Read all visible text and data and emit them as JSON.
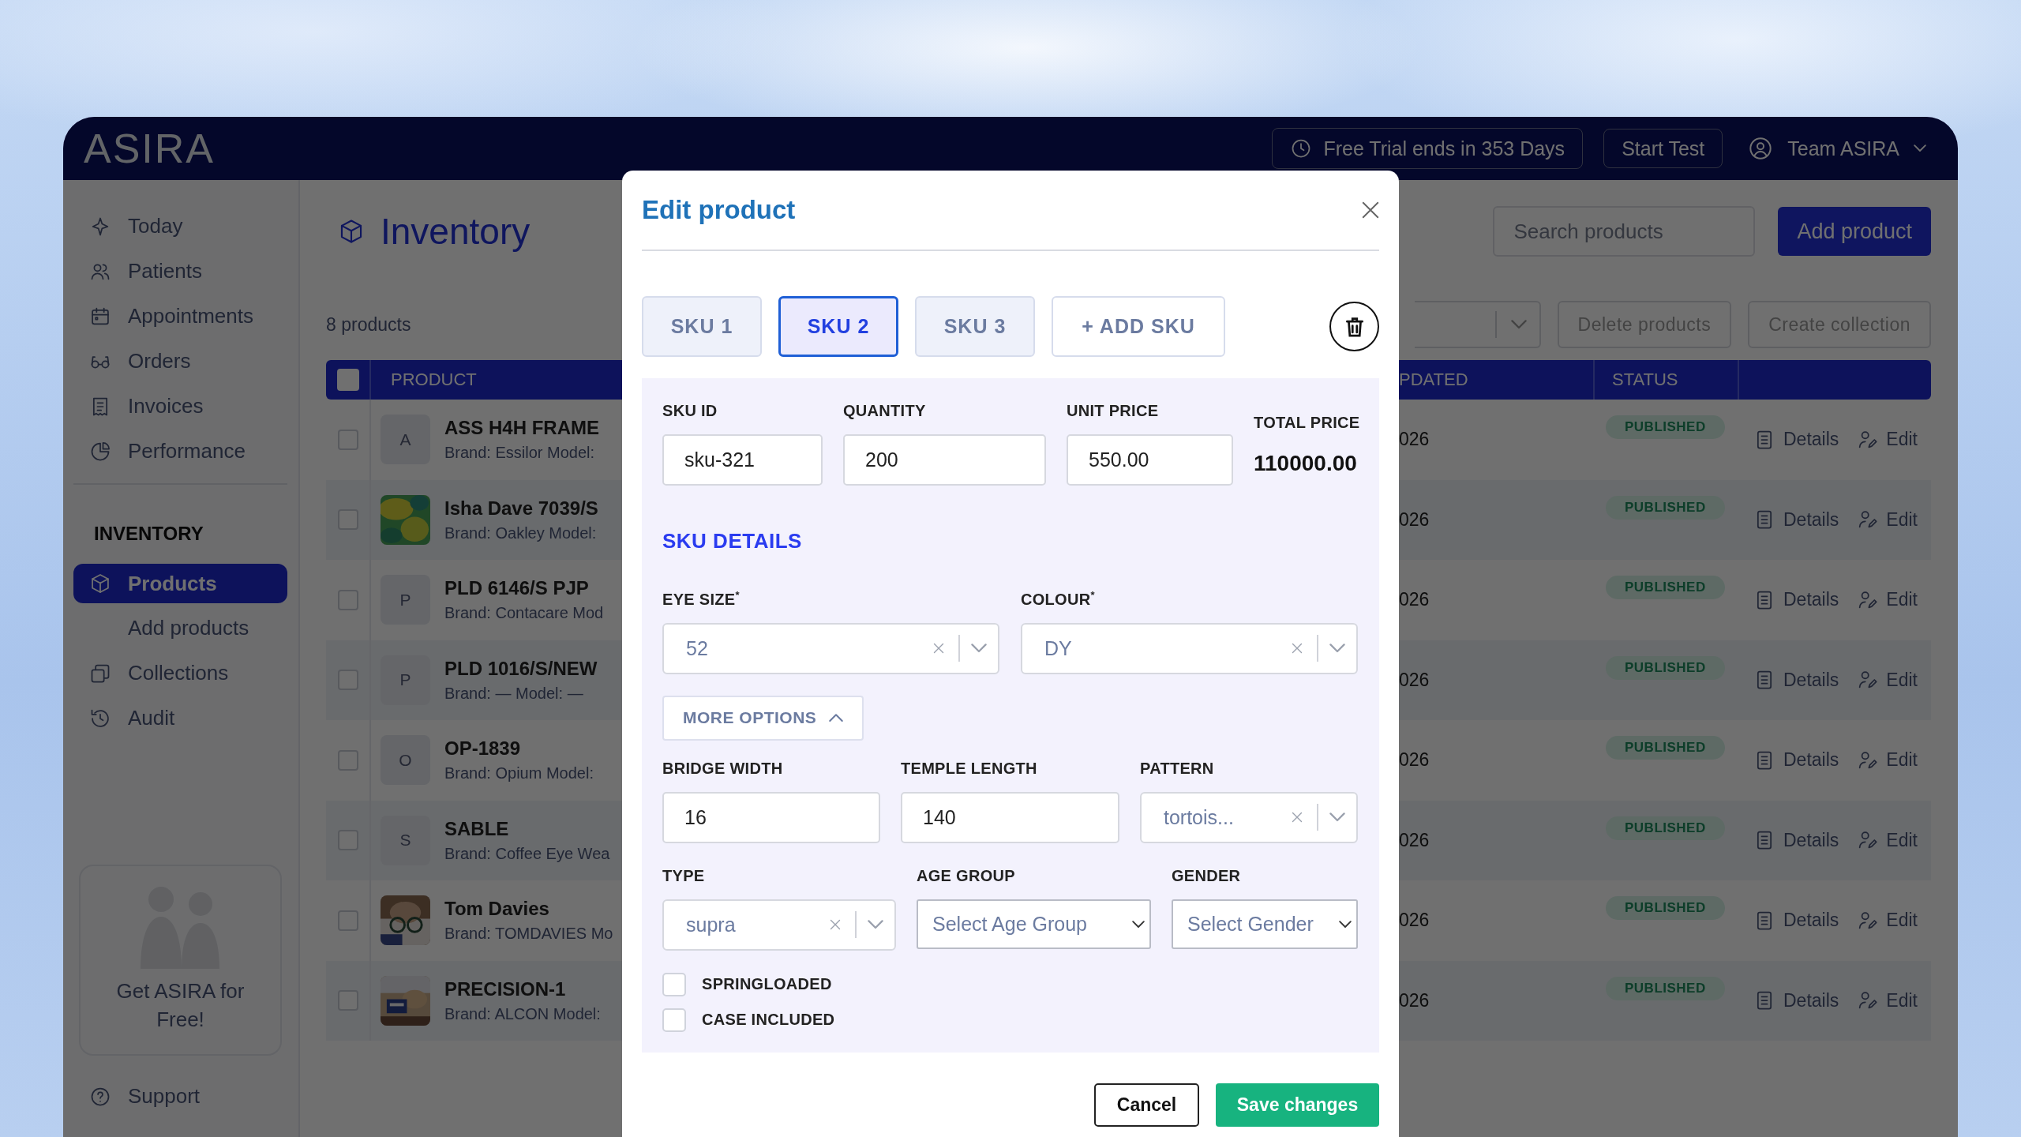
{
  "topbar": {
    "logo": "ASIRA",
    "trial": "Free Trial ends in 353 Days",
    "start_test": "Start Test",
    "user": "Team ASIRA"
  },
  "sidebar": {
    "items": [
      {
        "label": "Today",
        "selected": false
      },
      {
        "label": "Patients",
        "selected": false
      },
      {
        "label": "Appointments",
        "selected": false
      },
      {
        "label": "Orders",
        "selected": false
      },
      {
        "label": "Invoices",
        "selected": false
      },
      {
        "label": "Performance",
        "selected": false
      }
    ],
    "section": "INVENTORY",
    "inventory_items": [
      {
        "kind": "item",
        "label": "Products",
        "selected": true
      },
      {
        "kind": "subitem",
        "label": "Add products",
        "selected": false
      },
      {
        "kind": "item",
        "label": "Collections",
        "selected": false
      },
      {
        "kind": "item",
        "label": "Audit",
        "selected": false
      }
    ],
    "promo": "Get ASIRA for Free!",
    "support": "Support"
  },
  "page": {
    "title": "Inventory",
    "count": "8 products",
    "search": {
      "placeholder": "Search products"
    },
    "add_button": "Add product",
    "delete_button": "Delete products",
    "collection_button": "Create collection"
  },
  "table": {
    "select_all": {
      "checked": false
    },
    "columns": [
      "PRODUCT",
      "PDATED",
      "STATUS"
    ],
    "rows": [
      {
        "checked": false,
        "thumb": {
          "kind": "letter",
          "letter": "A"
        },
        "name": "ASS H4H FRAME",
        "brand": "Brand: Essilor Model:",
        "updated": "026",
        "status": "PUBLISHED",
        "details": "Details",
        "edit": "Edit"
      },
      {
        "checked": false,
        "name": "Isha Dave 7039/S",
        "brand": "Brand: Oakley Model:",
        "updated": "026",
        "status": "PUBLISHED",
        "details": "Details",
        "edit": "Edit"
      },
      {
        "checked": false,
        "thumb": {
          "kind": "letter",
          "letter": "P"
        },
        "name": "PLD 6146/S PJP",
        "brand": "Brand: Contacare Mod",
        "updated": "026",
        "status": "PUBLISHED",
        "details": "Details",
        "edit": "Edit"
      },
      {
        "checked": false,
        "thumb": {
          "kind": "letter",
          "letter": "P"
        },
        "name": "PLD 1016/S/NEW",
        "brand": "Brand: — Model: —",
        "updated": "026",
        "status": "PUBLISHED",
        "details": "Details",
        "edit": "Edit"
      },
      {
        "checked": false,
        "thumb": {
          "kind": "letter",
          "letter": "O"
        },
        "name": "OP-1839",
        "brand": "Brand: Opium Model:",
        "updated": "026",
        "status": "PUBLISHED",
        "details": "Details",
        "edit": "Edit"
      },
      {
        "checked": false,
        "thumb": {
          "kind": "letter",
          "letter": "S"
        },
        "name": "SABLE",
        "brand": "Brand: Coffee Eye Wea",
        "updated": "026",
        "status": "PUBLISHED",
        "details": "Details",
        "edit": "Edit"
      },
      {
        "checked": false,
        "name": "Tom Davies",
        "brand": "Brand: TOMDAVIES Mo",
        "updated": "026",
        "status": "PUBLISHED",
        "details": "Details",
        "edit": "Edit"
      },
      {
        "checked": false,
        "name": "PRECISION-1",
        "brand": "Brand: ALCON Model:",
        "updated": "026",
        "status": "PUBLISHED",
        "details": "Details",
        "edit": "Edit"
      }
    ]
  },
  "modal": {
    "title": "Edit product",
    "skus": [
      {
        "label": "SKU 1",
        "selected": false
      },
      {
        "label": "SKU 2",
        "selected": true
      },
      {
        "label": "SKU 3",
        "selected": false
      }
    ],
    "add_sku": "+ ADD SKU",
    "summary": [
      {
        "label": "SKU ID",
        "value": "sku-321"
      },
      {
        "label": "QUANTITY",
        "value": "200"
      },
      {
        "label": "UNIT PRICE",
        "value": "550.00"
      }
    ],
    "total": {
      "label": "TOTAL PRICE",
      "value": "110000.00"
    },
    "details_heading": "SKU DETAILS",
    "main_selects": [
      {
        "label": "EYE SIZE$^{*}$",
        "value": "52"
      },
      {
        "label": "COLOUR$^{*}$",
        "value": "DY"
      }
    ],
    "more_options": {
      "label": "MORE OPTIONS",
      "expanded": true
    },
    "extra_rows": [
      [
        {
          "kind": "input",
          "label": "BRIDGE WIDTH",
          "value": "16"
        },
        {
          "kind": "input",
          "label": "TEMPLE LENGTH",
          "value": "140"
        },
        {
          "kind": "select",
          "label": "PATTERN",
          "value": "tortois..."
        }
      ],
      [
        {
          "kind": "select",
          "label": "TYPE",
          "value": "supra"
        },
        {
          "kind": "native",
          "label": "AGE GROUP",
          "placeholder": "Select Age Group"
        },
        {
          "kind": "native",
          "label": "GENDER",
          "placeholder": "Select Gender"
        }
      ]
    ],
    "checkboxes": [
      {
        "label": "SPRINGLOADED",
        "checked": false
      },
      {
        "label": "CASE INCLUDED",
        "checked": false
      }
    ],
    "cancel": "Cancel",
    "save": "Save changes"
  }
}
